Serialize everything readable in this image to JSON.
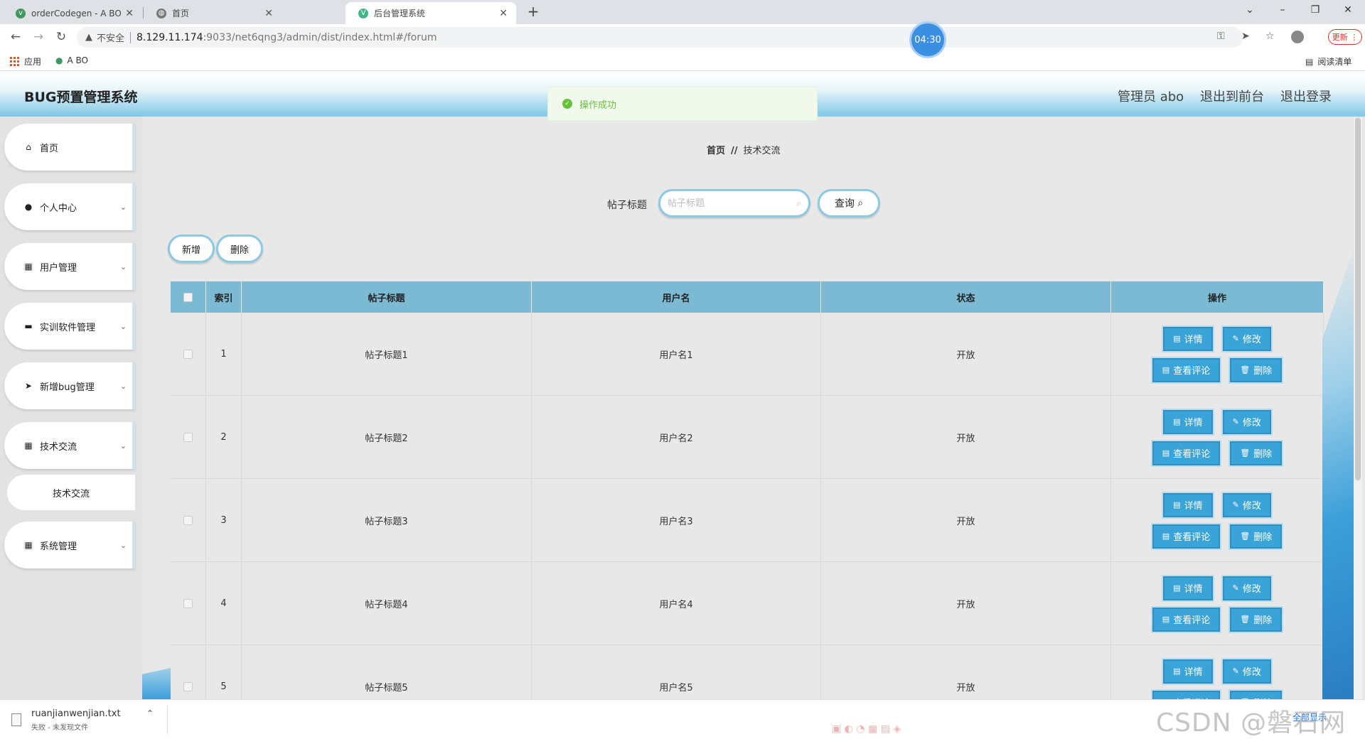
{
  "browser": {
    "tabs": [
      {
        "title": "orderCodegen - A BO",
        "active": false
      },
      {
        "title": "首页",
        "active": false
      },
      {
        "title": "后台管理系统",
        "active": true
      }
    ],
    "url": {
      "warning": "不安全",
      "host": "8.129.11.174",
      "path": ":9033/net6qng3/admin/dist/index.html#/forum"
    },
    "update_label": "更新",
    "timer": "04:30",
    "bookmarks": [
      {
        "label": "应用"
      },
      {
        "label": "A BO"
      }
    ],
    "reading_list": "阅读清单"
  },
  "header": {
    "title": "BUG预置管理系统",
    "user": "管理员 abo",
    "front": "退出到前台",
    "logout": "退出登录"
  },
  "toast": "操作成功",
  "sidebar": {
    "items": [
      {
        "label": "首页",
        "icon": "home-icon",
        "glyph": "⌂"
      },
      {
        "label": "个人中心",
        "icon": "user-icon",
        "glyph": "●"
      },
      {
        "label": "用户管理",
        "icon": "grid-icon",
        "glyph": "▦"
      },
      {
        "label": "实训软件管理",
        "icon": "briefcase-icon",
        "glyph": "▬"
      },
      {
        "label": "新增bug管理",
        "icon": "send-icon",
        "glyph": "➤"
      },
      {
        "label": "技术交流",
        "icon": "grid-icon",
        "glyph": "▦"
      },
      {
        "label": "系统管理",
        "icon": "grid-icon",
        "glyph": "▦"
      }
    ],
    "submenu": "技术交流"
  },
  "breadcrumb": {
    "home": "首页",
    "separator": "//",
    "current": "技术交流"
  },
  "search": {
    "label": "帖子标题",
    "placeholder": "帖子标题",
    "button": "查询"
  },
  "actions": {
    "add": "新增",
    "delete": "删除"
  },
  "table": {
    "headers": [
      "索引",
      "帖子标题",
      "用户名",
      "状态",
      "操作"
    ],
    "ops": {
      "detail": "详情",
      "edit": "修改",
      "comments": "查看评论",
      "delete": "删除"
    },
    "rows": [
      {
        "index": "1",
        "title": "帖子标题1",
        "user": "用户名1",
        "status": "开放"
      },
      {
        "index": "2",
        "title": "帖子标题2",
        "user": "用户名2",
        "status": "开放"
      },
      {
        "index": "3",
        "title": "帖子标题3",
        "user": "用户名3",
        "status": "开放"
      },
      {
        "index": "4",
        "title": "帖子标题4",
        "user": "用户名4",
        "status": "开放"
      },
      {
        "index": "5",
        "title": "帖子标题5",
        "user": "用户名5",
        "status": "开放"
      }
    ]
  },
  "download": {
    "file": "ruanjianwenjian.txt",
    "status": "失败 - 未发现文件",
    "show_all": "全部显示"
  },
  "watermark": "CSDN @磐石网络",
  "colors": {
    "accent": "#3aa3d7",
    "header_row": "#7cbad4",
    "success": "#67c23a"
  }
}
